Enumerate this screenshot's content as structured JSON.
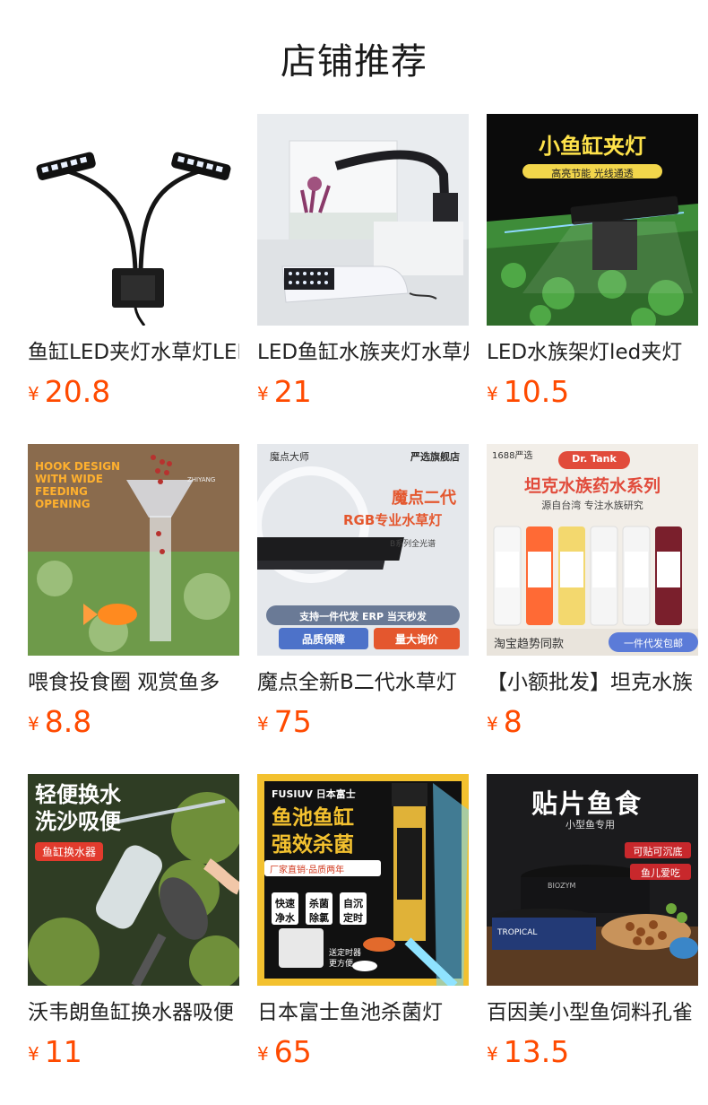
{
  "header": {
    "title": "店铺推荐"
  },
  "colors": {
    "price": "#ff4a00",
    "text": "#222222"
  },
  "products": [
    {
      "name": "鱼缸LED夹灯水草灯LED",
      "currency": "¥",
      "price": "20.8",
      "image": {
        "overlay": []
      }
    },
    {
      "name": "LED鱼缸水族夹灯水草灯",
      "currency": "¥",
      "price": "21",
      "image": {
        "overlay": []
      }
    },
    {
      "name": "LED水族架灯led夹灯",
      "currency": "¥",
      "price": "10.5",
      "image": {
        "overlay": [
          "小鱼缸夹灯",
          "高亮节能 光线通透"
        ]
      }
    },
    {
      "name": "喂食投食圈 观赏鱼多",
      "currency": "¥",
      "price": "8.8",
      "image": {
        "overlay": [
          "HOOK DESIGN",
          "WITH WIDE",
          "FEEDING",
          "OPENING",
          "ZHIYANG"
        ]
      }
    },
    {
      "name": "魔点全新B二代水草灯",
      "currency": "¥",
      "price": "75",
      "image": {
        "overlay": [
          "魔点大师",
          "严选旗舰店",
          "魔点二代",
          "RGB专业水草灯",
          "B系列全光谱",
          "支持一件代发 ERP 当天秒发",
          "品质保障",
          "量大询价"
        ]
      }
    },
    {
      "name": "【小额批发】坦克水族",
      "currency": "¥",
      "price": "8",
      "image": {
        "overlay": [
          "1688严选",
          "Dr. Tank",
          "坦克水族药水系列",
          "源自台湾 专注水族研究",
          "淘宝趋势同款",
          "一件代发包邮"
        ]
      }
    },
    {
      "name": "沃韦朗鱼缸换水器吸便",
      "currency": "¥",
      "price": "11",
      "image": {
        "overlay": [
          "轻便换水",
          "洗沙吸便",
          "鱼缸换水器"
        ]
      }
    },
    {
      "name": "日本富士鱼池杀菌灯",
      "currency": "¥",
      "price": "65",
      "image": {
        "overlay": [
          "FUSIUV 日本富士",
          "鱼池鱼缸",
          "强效杀菌",
          "厂家直销·品质两年",
          "快速净水",
          "杀菌除氯",
          "自沉定时",
          "送定时器",
          "更方便"
        ]
      }
    },
    {
      "name": "百因美小型鱼饲料孔雀",
      "currency": "¥",
      "price": "13.5",
      "image": {
        "overlay": [
          "贴片鱼食",
          "小型鱼专用",
          "可贴可沉底",
          "鱼儿爱吃",
          "TROPICAL",
          "BIOZYM"
        ]
      }
    }
  ]
}
